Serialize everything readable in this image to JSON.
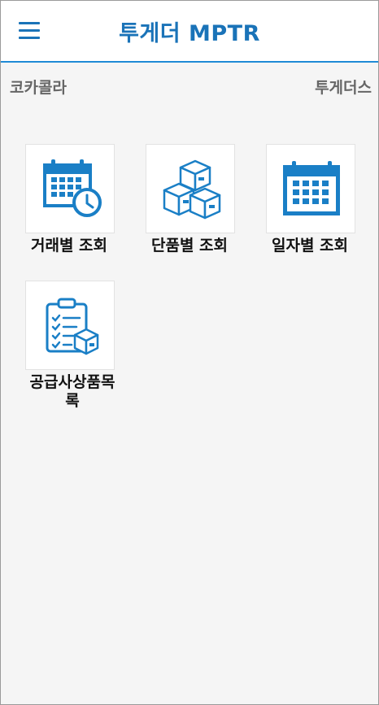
{
  "header": {
    "title": "투게더 MPTR"
  },
  "info": {
    "company": "코카콜라",
    "user": "투게더스"
  },
  "menu": [
    {
      "label": "거래별 조회",
      "icon": "calendar-clock-icon"
    },
    {
      "label": "단품별 조회",
      "icon": "boxes-icon"
    },
    {
      "label": "일자별 조회",
      "icon": "calendar-icon"
    },
    {
      "label": "공급사상품목록",
      "icon": "clipboard-checklist-box-icon"
    }
  ],
  "colors": {
    "accent": "#1f8ad6",
    "icon": "#1a7fc6",
    "title": "#1a73b8"
  }
}
